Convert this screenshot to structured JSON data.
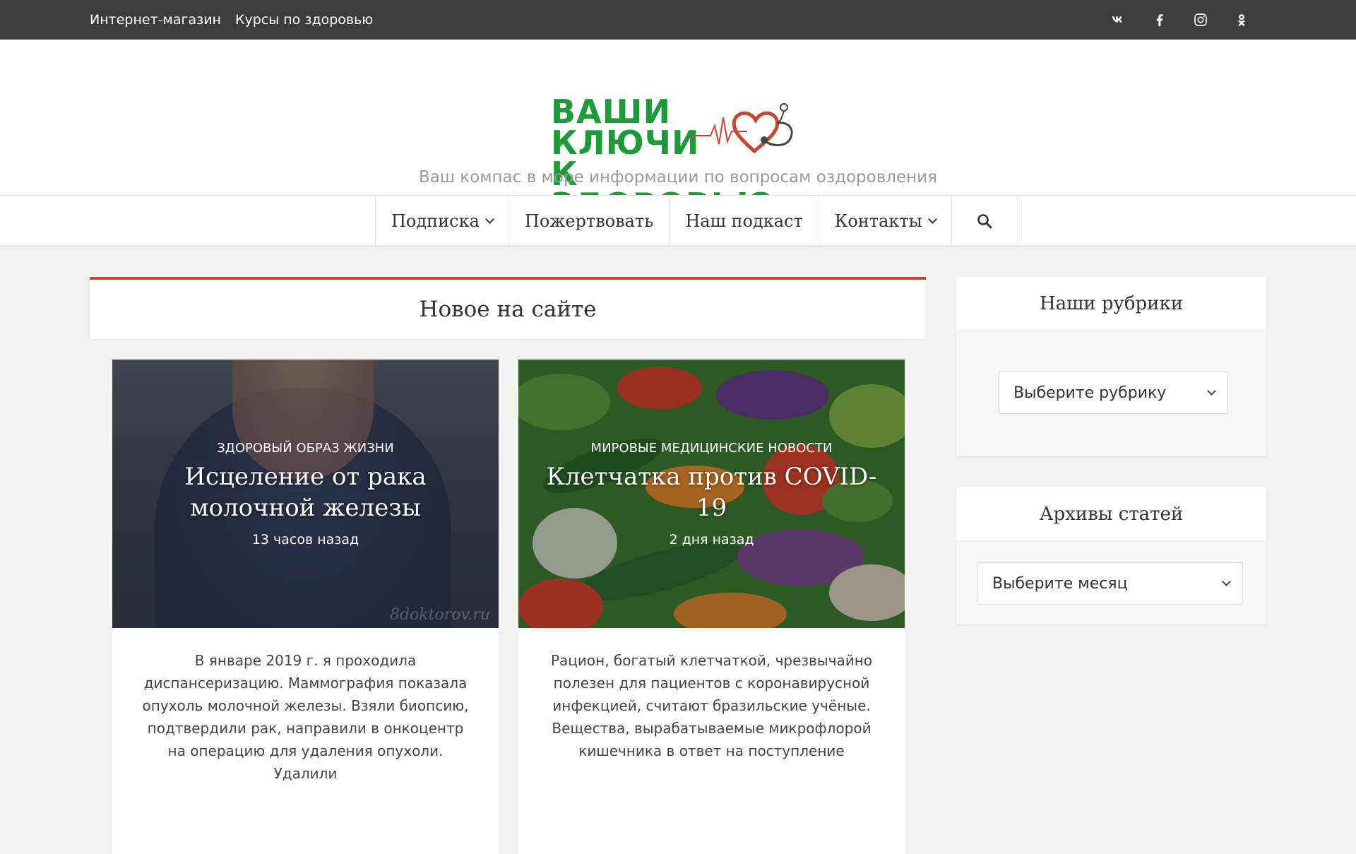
{
  "topbar": {
    "links": [
      "Интернет-магазин",
      "Курсы по здоровью"
    ],
    "social_icons": [
      "vk-icon",
      "facebook-icon",
      "instagram-icon",
      "odnoklassniki-icon"
    ]
  },
  "header": {
    "logo_lines": [
      "ВАШИ",
      "КЛЮЧИ",
      "К ЗДОРОВЬЮ"
    ],
    "tagline": "Ваш компас в море информации по вопросам оздоровления"
  },
  "nav": {
    "items": [
      "Подписка",
      "Пожертвовать",
      "Наш подкаст",
      "Контакты"
    ],
    "search_icon": "search-icon"
  },
  "main": {
    "section_title": "Новое на сайте",
    "cards": [
      {
        "category": "Здоровый образ жизни",
        "title": "Исцеление от рака молочной железы",
        "time": "13 часов назад",
        "watermark": "8doktorov.ru",
        "excerpt": "В январе 2019 г. я проходила диспансеризацию. Маммография показала опухоль молочной железы. Взяли биопсию, подтвердили рак, направили в онкоцентр на операцию для удаления опухоли. Удалили"
      },
      {
        "category": "Мировые медицинские новости",
        "title": "Клетчатка против COVID-19",
        "time": "2 дня назад",
        "excerpt": "Рацион, богатый клетчаткой, чрезвычайно полезен для пациентов с коронавирусной инфекцией, считают бразильские учёные. Вещества, вырабатываемые микрофлорой кишечника в ответ на поступление"
      }
    ]
  },
  "sidebar": {
    "rubrics_title": "Наши рубрики",
    "rubrics_select": "Выберите рубрику",
    "archives_title": "Архивы статей",
    "archives_select": "Выберите месяц"
  },
  "colors": {
    "topbar_bg": "#3d3d3d",
    "accent": "#c9452f",
    "logo_green": "#1f9a3a"
  }
}
